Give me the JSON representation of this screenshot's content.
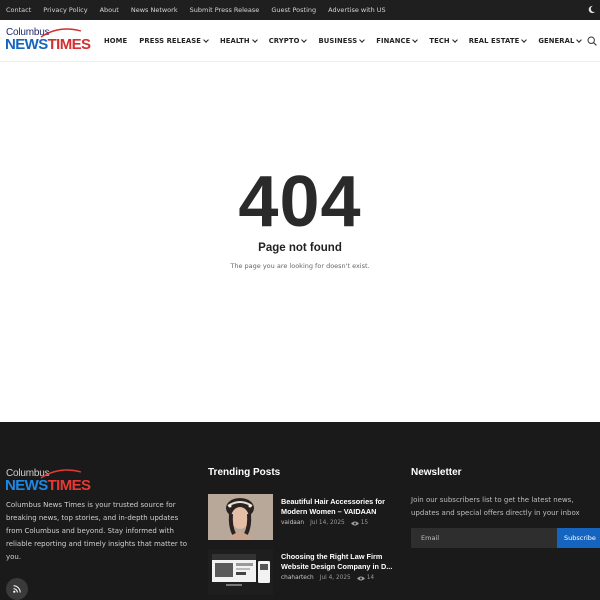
{
  "topbar": {
    "links": [
      "Contact",
      "Privacy Policy",
      "About",
      "News Network",
      "Submit Press Release",
      "Guest Posting",
      "Advertise with US"
    ]
  },
  "logo": {
    "line1": "Columbus",
    "news": "NEWS",
    "times": "TIMES"
  },
  "nav": {
    "items": [
      {
        "label": "HOME",
        "dropdown": false
      },
      {
        "label": "PRESS RELEASE",
        "dropdown": true
      },
      {
        "label": "HEALTH",
        "dropdown": true
      },
      {
        "label": "CRYPTO",
        "dropdown": true
      },
      {
        "label": "BUSINESS",
        "dropdown": true
      },
      {
        "label": "FINANCE",
        "dropdown": true
      },
      {
        "label": "TECH",
        "dropdown": true
      },
      {
        "label": "REAL ESTATE",
        "dropdown": true
      },
      {
        "label": "GENERAL",
        "dropdown": true
      }
    ]
  },
  "error": {
    "code": "404",
    "title": "Page not found",
    "subtitle": "The page you are looking for doesn't exist."
  },
  "footer": {
    "about": "Columbus News Times is your trusted source for breaking news, top stories, and in-depth updates from Columbus and beyond. Stay informed with reliable reporting and timely insights that matter to you.",
    "trending": {
      "title": "Trending Posts",
      "posts": [
        {
          "title": "Beautiful Hair Accessories for Modern Women – VAIDAAN",
          "author": "vaidaan",
          "date": "Jul 14, 2025",
          "views": "15"
        },
        {
          "title": "Choosing the Right Law Firm Website Design Company in D...",
          "author": "chahartech",
          "date": "Jul 4, 2025",
          "views": "14"
        }
      ]
    },
    "newsletter": {
      "title": "Newsletter",
      "text": "Join our subscribers list to get the latest news, updates and special offers directly in your inbox",
      "placeholder": "Email",
      "button": "Subscribe"
    }
  },
  "colors": {
    "topbar": "#1f1f1f",
    "footer": "#1a1a1a",
    "accent": "#1565c0",
    "brand_red": "#d32f2f"
  },
  "icons": {
    "theme_toggle": "moon-icon",
    "search": "search-icon",
    "rss": "rss-icon",
    "views": "eye-icon"
  }
}
